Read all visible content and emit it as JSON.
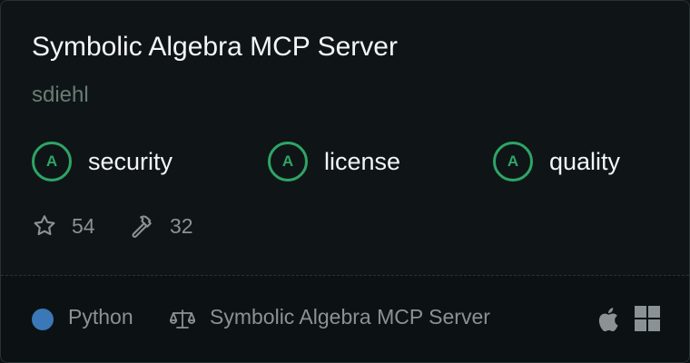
{
  "server": {
    "title": "Symbolic Algebra MCP Server",
    "owner": "sdiehl"
  },
  "grades": [
    {
      "grade": "A",
      "label": "security"
    },
    {
      "grade": "A",
      "label": "license"
    },
    {
      "grade": "A",
      "label": "quality"
    }
  ],
  "stats": {
    "stars": "54",
    "tools": "32"
  },
  "footer": {
    "language": "Python",
    "license": "Symbolic Algebra MCP Server",
    "platforms": [
      "apple-icon",
      "windows-icon"
    ]
  },
  "colors": {
    "grade_accent": "#2ea566",
    "language_python": "#3a78b8",
    "background": "#0f1517"
  }
}
